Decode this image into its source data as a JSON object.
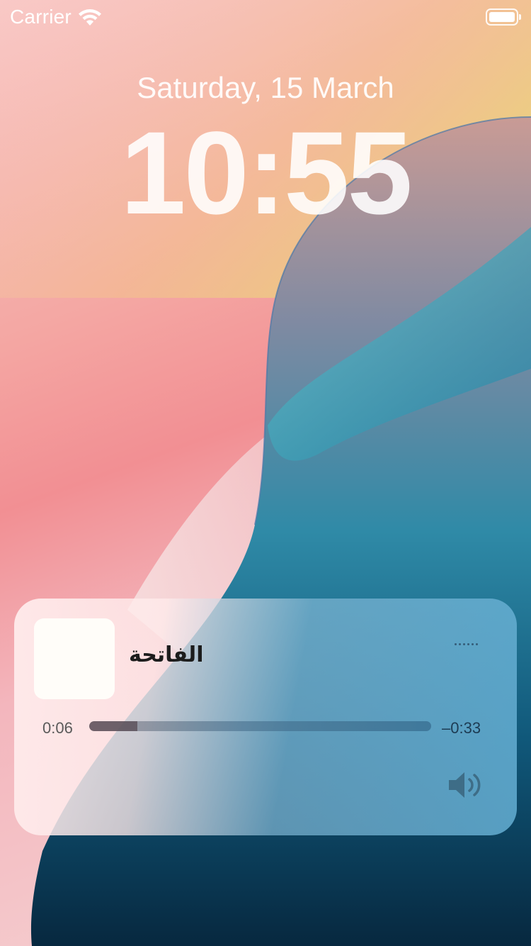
{
  "status_bar": {
    "carrier": "Carrier",
    "wifi_icon": "wifi-icon",
    "battery_icon": "battery-icon"
  },
  "lock_screen": {
    "date": "Saturday, 15 March",
    "time": "10:55"
  },
  "now_playing": {
    "title": "الفاتحة",
    "elapsed": "0:06",
    "remaining": "–0:33",
    "progress_fraction": 0.14,
    "more_icon": "more-dots-icon",
    "volume_icon": "speaker-volume-icon",
    "artwork_icon": "album-artwork-placeholder"
  }
}
